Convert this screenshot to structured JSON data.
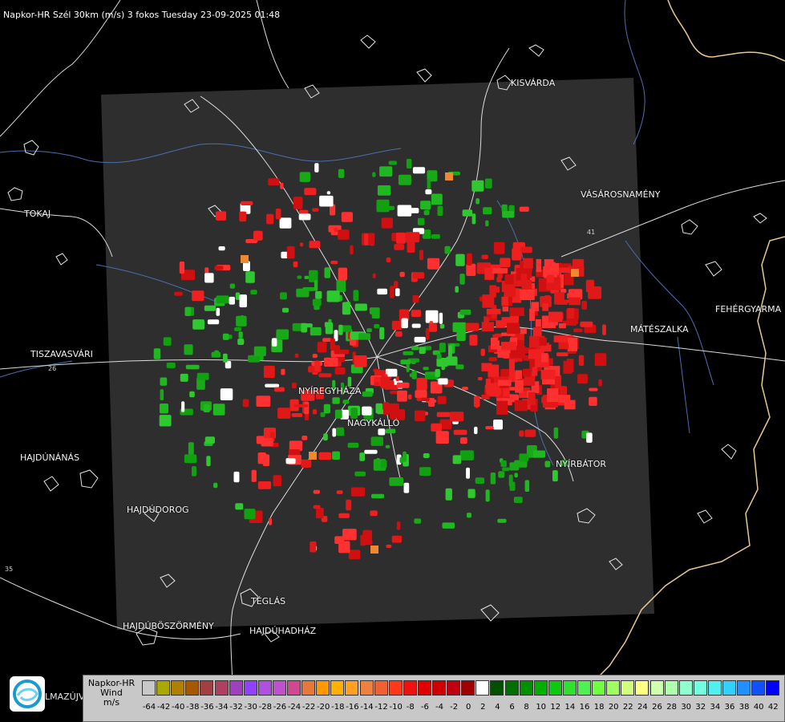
{
  "title": "Napkor-HR Szél 30km (m/s) 3 fokos Tuesday 23-09-2025 01:48",
  "towns": [
    {
      "name": "KISVÁRDA",
      "key": "kisvarda"
    },
    {
      "name": "VÁSÁROSNAMÉNY",
      "key": "vasarosnameny"
    },
    {
      "name": "TOKAJ",
      "key": "tokaj"
    },
    {
      "name": "FEHÉRGYARMA",
      "key": "fehergyarmat"
    },
    {
      "name": "MÁTÉSZALKA",
      "key": "mateszalka"
    },
    {
      "name": "TISZAVASVÁRI",
      "key": "tiszavasvari"
    },
    {
      "name": "NYÍREGYHÁZA",
      "key": "nyiregyhaza"
    },
    {
      "name": "NAGYKÁLLÓ",
      "key": "nagykallo"
    },
    {
      "name": "HAJDÚNÁNÁS",
      "key": "hajdunanas"
    },
    {
      "name": "NYÍRBÁTOR",
      "key": "nyirbator"
    },
    {
      "name": "HAJDÚDOROG",
      "key": "hajdudorog"
    },
    {
      "name": "TÉGLÁS",
      "key": "teglas"
    },
    {
      "name": "HAJDÚBÖSZÖRMÉNY",
      "key": "hajduboszormeny"
    },
    {
      "name": "HAJDÚHADHÁZ",
      "key": "hajduhadhaz"
    }
  ],
  "road_numbers": [
    "26",
    "35",
    "41"
  ],
  "logo_text": "LMAZÚJVÁR",
  "legend": {
    "title_lines": [
      "Napkor-HR",
      "Wind",
      "m/s"
    ],
    "values": [
      -64,
      -42,
      -40,
      -38,
      -36,
      -34,
      -32,
      -30,
      -28,
      -26,
      -24,
      -22,
      -20,
      -18,
      -16,
      -14,
      -12,
      -10,
      -8,
      -6,
      -4,
      -2,
      0,
      2,
      4,
      6,
      8,
      10,
      12,
      14,
      16,
      18,
      20,
      22,
      24,
      26,
      28,
      30,
      32,
      34,
      36,
      38,
      40,
      42
    ],
    "colors": [
      "#c8c8c8",
      "#a8a800",
      "#b08000",
      "#a85800",
      "#a04040",
      "#b04060",
      "#a040c0",
      "#9040ff",
      "#b050e0",
      "#c050d0",
      "#d04890",
      "#e87838",
      "#ff9800",
      "#ffb000",
      "#ffa020",
      "#f08040",
      "#f06030",
      "#ff3818",
      "#f01010",
      "#e00000",
      "#d00000",
      "#c00010",
      "#a00000",
      "#ffffff",
      "#005000",
      "#007000",
      "#009000",
      "#00b000",
      "#10c810",
      "#30e030",
      "#50f050",
      "#70ff40",
      "#a0ff60",
      "#d0ff80",
      "#ffff80",
      "#d0ffb0",
      "#b0ffb0",
      "#90ffd0",
      "#70ffe0",
      "#50f0f0",
      "#30d0ff",
      "#2090ff",
      "#1050ff",
      "#0000ff"
    ]
  },
  "colors": {
    "background": "#000000",
    "radar_panel": "#2e2e2e",
    "borders": "#ffffff",
    "rivers": "#4a6fb0",
    "country_border": "#e8c890"
  }
}
